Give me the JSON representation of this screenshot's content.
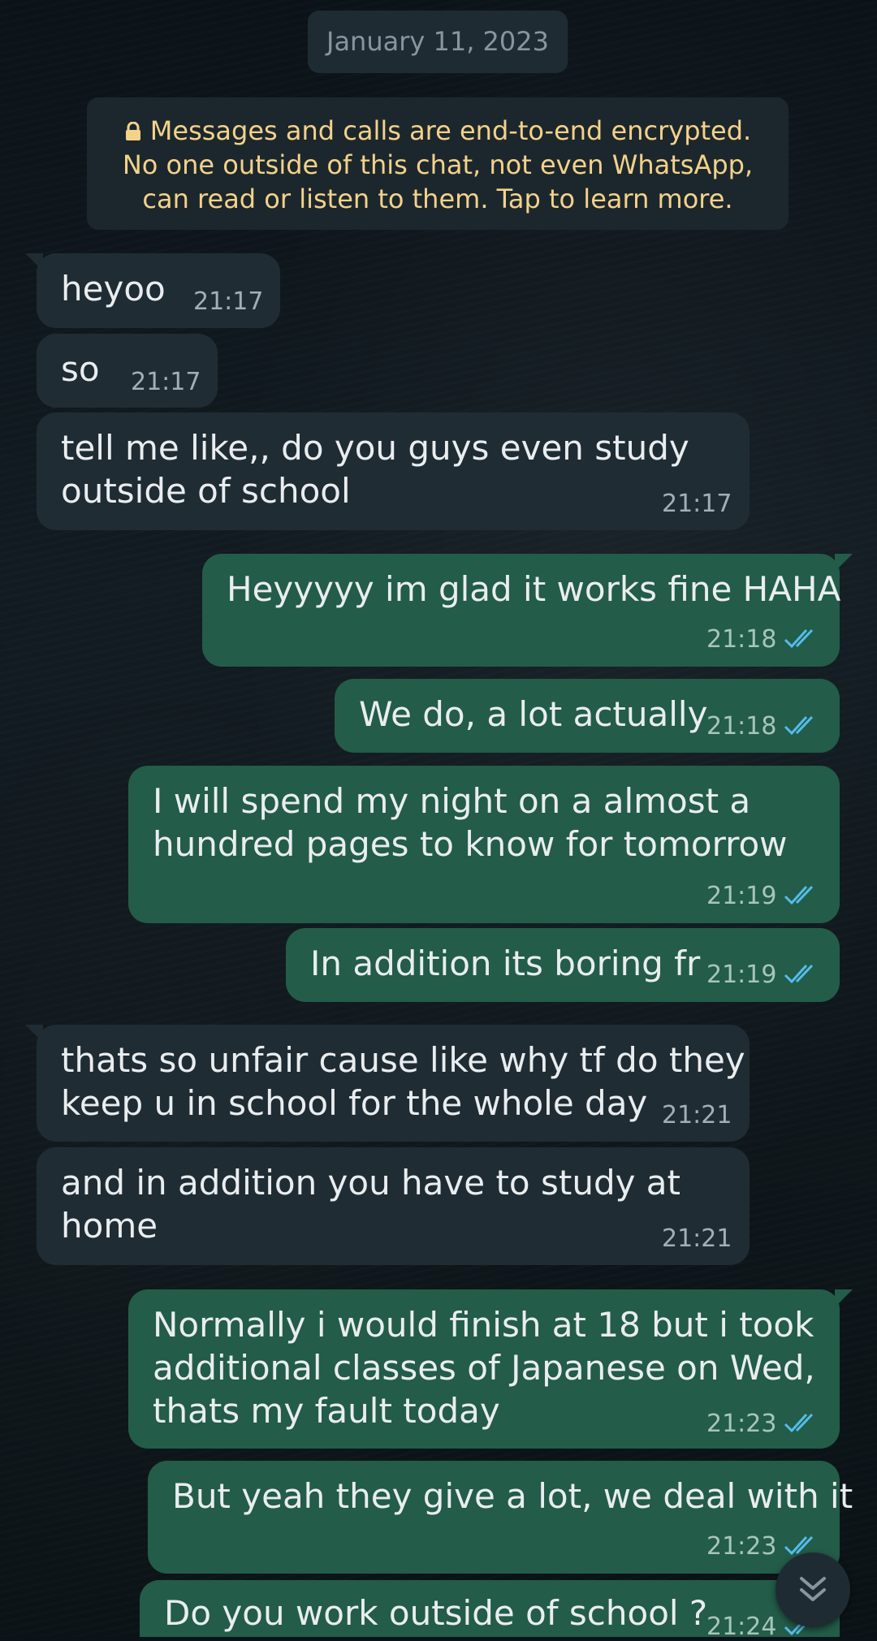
{
  "date_chip": "January 11, 2023",
  "encryption_notice": {
    "line1": "Messages and calls are end-to-end encrypted.",
    "line2": "No one outside of this chat, not even WhatsApp,",
    "line3": "can read or listen to them. Tap to learn more.",
    "icon": "lock-icon"
  },
  "messages": [
    {
      "direction": "incoming",
      "lines": [
        "heyoo"
      ],
      "time": "21:17"
    },
    {
      "direction": "incoming",
      "lines": [
        "so"
      ],
      "time": "21:17"
    },
    {
      "direction": "incoming",
      "lines": [
        "tell me like,, do you guys even study",
        "outside of school"
      ],
      "time": "21:17"
    },
    {
      "direction": "outgoing",
      "lines": [
        "Heyyyyy im glad it works fine HAHA"
      ],
      "time": "21:18",
      "status": "read"
    },
    {
      "direction": "outgoing",
      "lines": [
        "We do, a lot actually"
      ],
      "time": "21:18",
      "status": "read"
    },
    {
      "direction": "outgoing",
      "lines": [
        "I will spend my night on a almost a",
        "hundred pages to know for tomorrow"
      ],
      "time": "21:19",
      "status": "read"
    },
    {
      "direction": "outgoing",
      "lines": [
        "In addition its boring fr"
      ],
      "time": "21:19",
      "status": "read"
    },
    {
      "direction": "incoming",
      "lines": [
        "thats so unfair cause like why tf do they",
        "keep u in school for the whole day"
      ],
      "time": "21:21"
    },
    {
      "direction": "incoming",
      "lines": [
        "and in addition you have to study at",
        "home"
      ],
      "time": "21:21"
    },
    {
      "direction": "outgoing",
      "lines": [
        "Normally i would finish at 18 but i took",
        "additional classes of Japanese on Wed,",
        "thats my fault today"
      ],
      "time": "21:23",
      "status": "read"
    },
    {
      "direction": "outgoing",
      "lines": [
        "But yeah they give a lot, we deal with it"
      ],
      "time": "21:23",
      "status": "read"
    },
    {
      "direction": "outgoing",
      "lines": [
        "Do you work outside of school ?"
      ],
      "time": "21:24",
      "status": "read"
    }
  ],
  "colors": {
    "incoming_bubble": "#202c33",
    "outgoing_bubble": "#235c48",
    "read_ticks": "#53bdeb",
    "notice_text": "#f3d28a"
  },
  "scroll_button_icon": "double-chevron-down-icon"
}
